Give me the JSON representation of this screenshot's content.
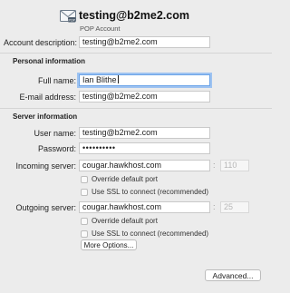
{
  "header": {
    "account_email": "testing@b2me2.com",
    "account_type": "POP Account",
    "icon": "envelope-icon"
  },
  "account": {
    "description_label": "Account description:",
    "description_value": "testing@b2me2.com"
  },
  "personal": {
    "section_title": "Personal information",
    "full_name_label": "Full name:",
    "full_name_value": "Ian Blithe",
    "email_label": "E-mail address:",
    "email_value": "testing@b2me2.com"
  },
  "server": {
    "section_title": "Server information",
    "username_label": "User name:",
    "username_value": "testing@b2me2.com",
    "password_label": "Password:",
    "password_value": "••••••••••",
    "incoming_label": "Incoming server:",
    "incoming_value": "cougar.hawkhost.com",
    "incoming_port": "110",
    "incoming_override_label": "Override default port",
    "incoming_ssl_label": "Use SSL to connect (recommended)",
    "outgoing_label": "Outgoing server:",
    "outgoing_value": "cougar.hawkhost.com",
    "outgoing_port": "25",
    "outgoing_override_label": "Override default port",
    "outgoing_ssl_label": "Use SSL to connect (recommended)",
    "more_options_label": "More Options...",
    "port_separator": ":"
  },
  "footer": {
    "advanced_label": "Advanced..."
  }
}
